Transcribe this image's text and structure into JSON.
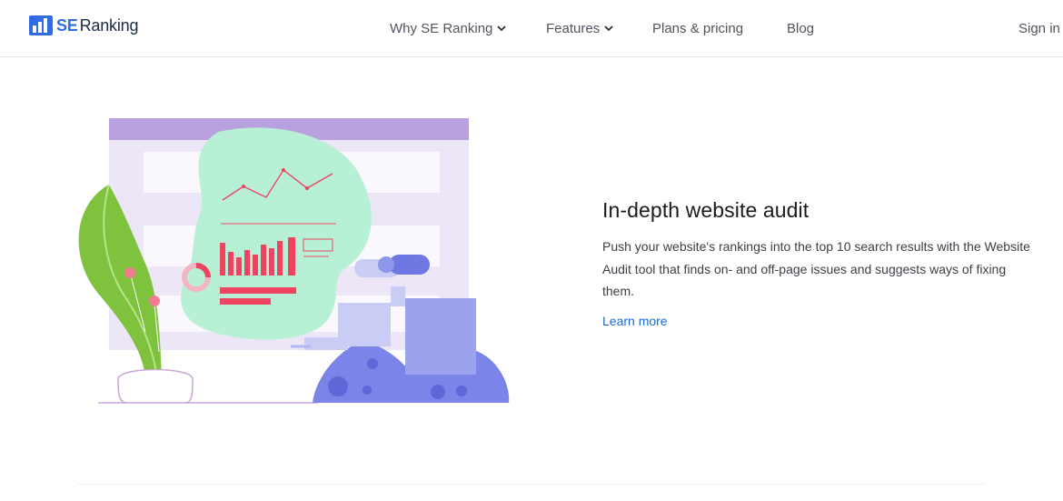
{
  "brand": {
    "logo_se": "SE",
    "logo_ranking": "Ranking",
    "logo_icon": "bar-chart-icon",
    "accent": "#2f6ce5"
  },
  "nav": {
    "items": [
      {
        "label": "Why SE Ranking",
        "has_dropdown": true
      },
      {
        "label": "Features",
        "has_dropdown": true
      },
      {
        "label": "Plans & pricing",
        "has_dropdown": false
      },
      {
        "label": "Blog",
        "has_dropdown": false
      }
    ],
    "sign_in": "Sign in"
  },
  "feature": {
    "title": "In-depth website audit",
    "description": "Push your website's rankings into the top 10 search results with the Website Audit tool that finds on- and off-page issues and suggests ways of fixing them.",
    "link_label": "Learn more",
    "link_color": "#1c6ad6"
  },
  "illustration": {
    "name": "website-audit-illustration",
    "colors": {
      "purple": "#b9a0de",
      "mint": "#b8f0d6",
      "red": "#ee4462",
      "blue": "#7b84e8",
      "green": "#7fc23d"
    }
  }
}
